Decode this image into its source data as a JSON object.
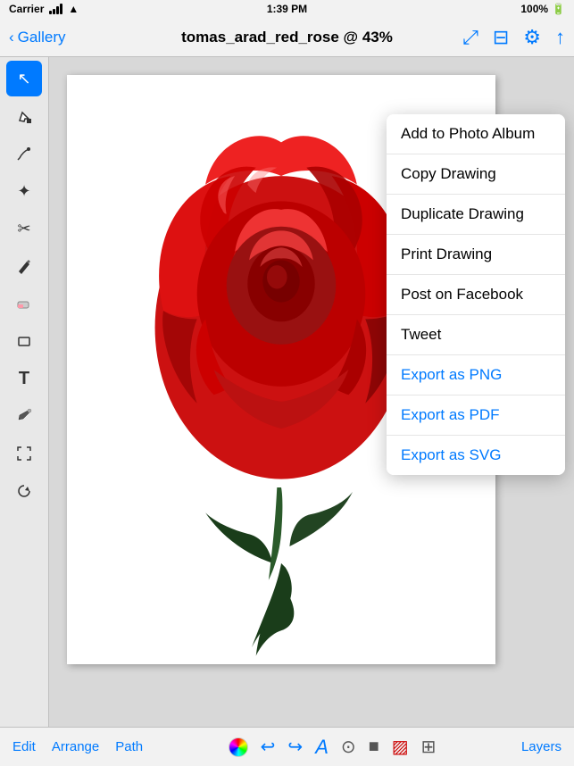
{
  "status_bar": {
    "carrier": "Carrier",
    "wifi": "wifi",
    "time": "1:39 PM",
    "battery": "100%"
  },
  "nav_bar": {
    "back_label": "Gallery",
    "title": "tomas_arad_red_rose @ 43%",
    "icon_fullscreen": "⤢",
    "icon_image": "🖼",
    "icon_settings": "⚙",
    "icon_share": "⬆"
  },
  "toolbar": {
    "tools": [
      {
        "name": "select",
        "icon": "↖",
        "active": true
      },
      {
        "name": "node-select",
        "icon": "↗",
        "active": false
      },
      {
        "name": "pen",
        "icon": "✒",
        "active": false
      },
      {
        "name": "node",
        "icon": "✦",
        "active": false
      },
      {
        "name": "scissors",
        "icon": "✂",
        "active": false
      },
      {
        "name": "pencil",
        "icon": "✏",
        "active": false
      },
      {
        "name": "eraser",
        "icon": "◻",
        "active": false
      },
      {
        "name": "rectangle",
        "icon": "▭",
        "active": false
      },
      {
        "name": "text",
        "icon": "T",
        "active": false
      },
      {
        "name": "eyedropper",
        "icon": "💉",
        "active": false
      },
      {
        "name": "zoom",
        "icon": "⤢",
        "active": false
      },
      {
        "name": "rotate",
        "icon": "↺",
        "active": false
      }
    ]
  },
  "dropdown": {
    "items": [
      {
        "label": "Add to Photo Album",
        "color": "black"
      },
      {
        "label": "Copy Drawing",
        "color": "black"
      },
      {
        "label": "Duplicate Drawing",
        "color": "black"
      },
      {
        "label": "Print Drawing",
        "color": "black"
      },
      {
        "label": "Post on Facebook",
        "color": "black"
      },
      {
        "label": "Tweet",
        "color": "black"
      },
      {
        "label": "Export as PNG",
        "color": "blue"
      },
      {
        "label": "Export as PDF",
        "color": "blue"
      },
      {
        "label": "Export as SVG",
        "color": "blue"
      }
    ]
  },
  "bottom_bar": {
    "left_items": [
      "Edit",
      "Arrange",
      "Path"
    ],
    "right_label": "Layers"
  }
}
